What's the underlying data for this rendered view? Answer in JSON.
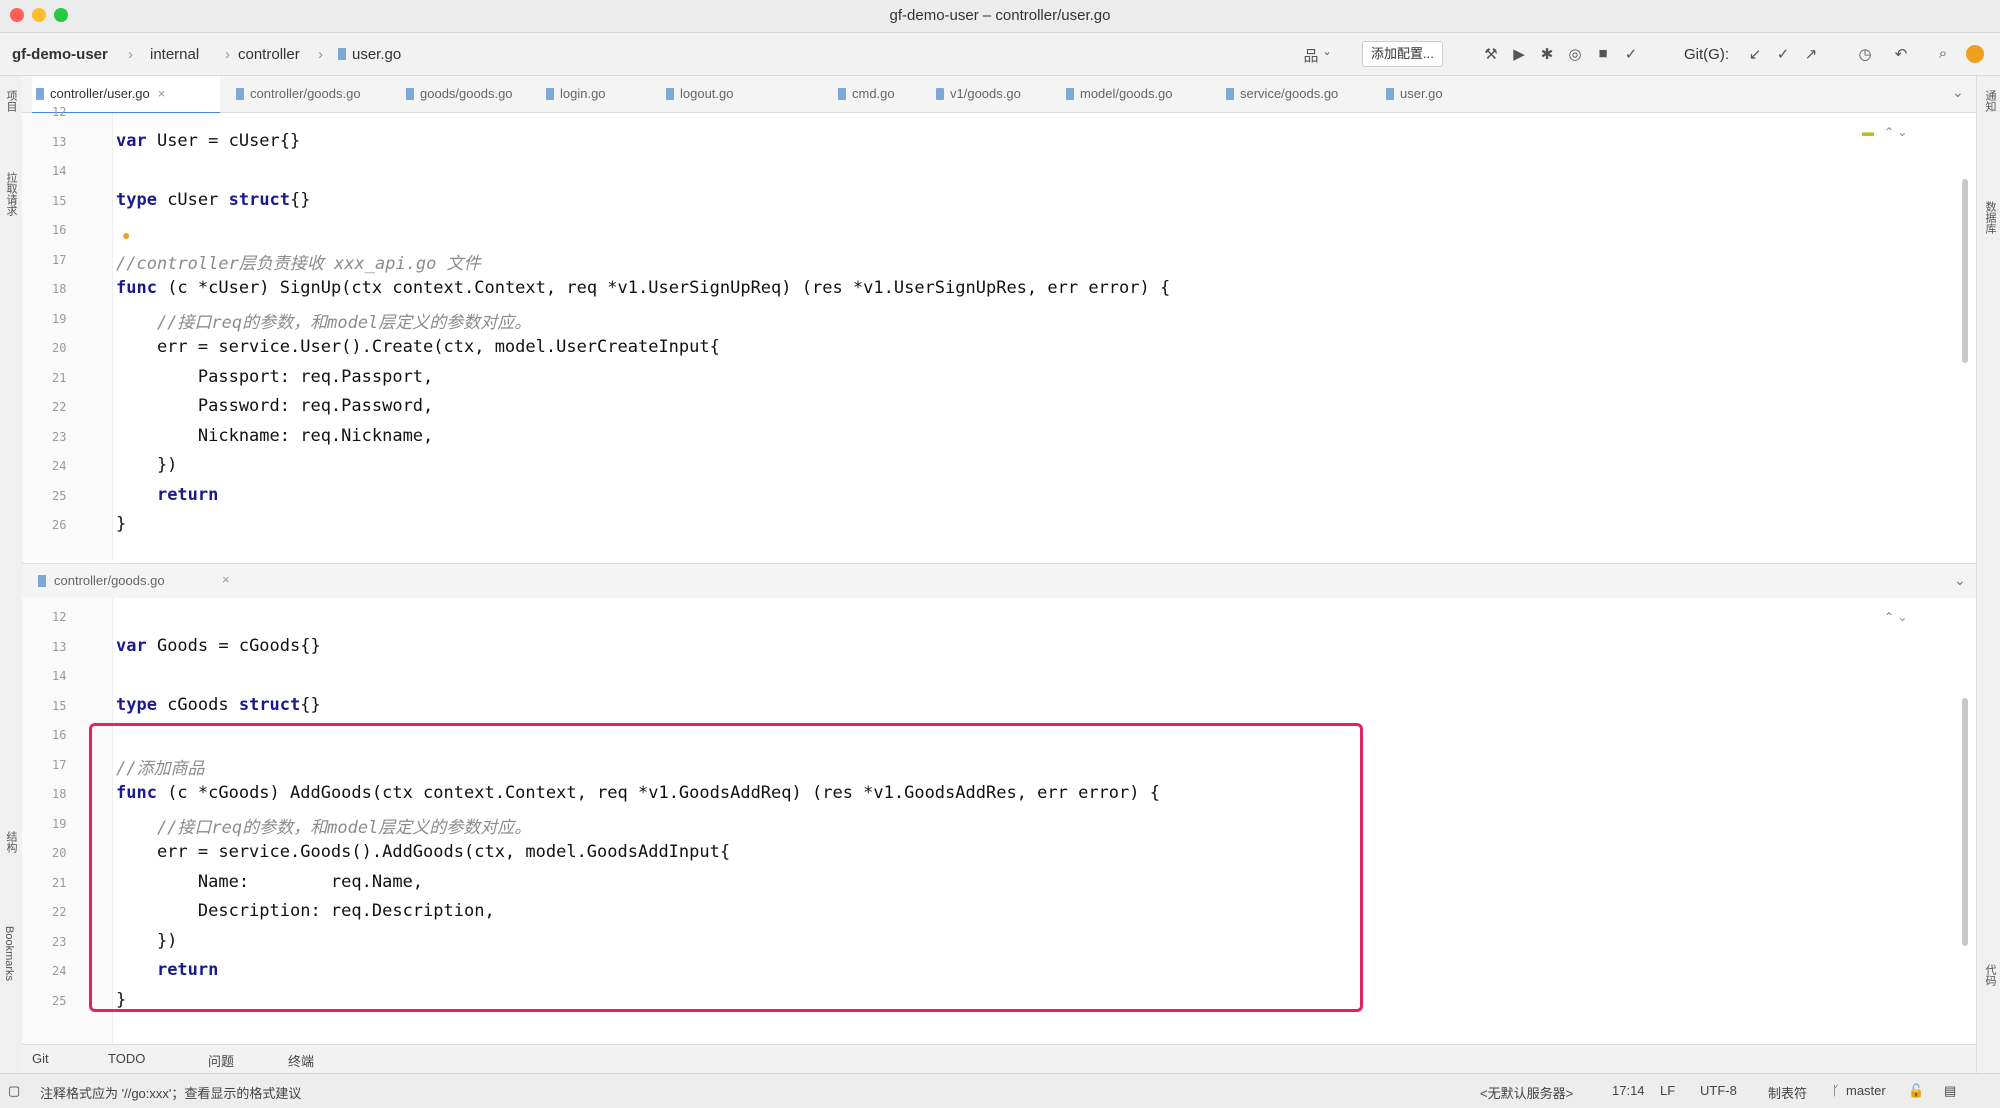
{
  "window": {
    "title": "gf-demo-user – controller/user.go"
  },
  "breadcrumb": [
    "gf-demo-user",
    "internal",
    "controller",
    "user.go"
  ],
  "toolbar": {
    "user_label": "品",
    "config_select": "添加配置...",
    "git_label": "Git(G):"
  },
  "left_strip": [
    "项目",
    "拉取请求",
    "结构",
    "Bookmarks"
  ],
  "right_strip": [
    "通知",
    "数据库",
    "代码"
  ],
  "tabs": [
    {
      "label": "controller/user.go",
      "active": true
    },
    {
      "label": "controller/goods.go"
    },
    {
      "label": "goods/goods.go"
    },
    {
      "label": "login.go"
    },
    {
      "label": "logout.go"
    },
    {
      "label": "cmd.go"
    },
    {
      "label": "v1/goods.go"
    },
    {
      "label": "model/goods.go"
    },
    {
      "label": "service/goods.go"
    },
    {
      "label": "user.go"
    }
  ],
  "editor_top": {
    "lines": [
      {
        "n": "12",
        "text": ""
      },
      {
        "n": "13",
        "text": "var User = cUser{}"
      },
      {
        "n": "14",
        "text": ""
      },
      {
        "n": "15",
        "text": "type cUser struct{}"
      },
      {
        "n": "16",
        "text": ""
      },
      {
        "n": "17",
        "text": "//controller层负责接收 xxx_api.go 文件"
      },
      {
        "n": "18",
        "text": "func (c *cUser) SignUp(ctx context.Context, req *v1.UserSignUpReq) (res *v1.UserSignUpRes, err error) {"
      },
      {
        "n": "19",
        "text": "    //接口req的参数，和model层定义的参数对应。"
      },
      {
        "n": "20",
        "text": "    err = service.User().Create(ctx, model.UserCreateInput{"
      },
      {
        "n": "21",
        "text": "        Passport: req.Passport,"
      },
      {
        "n": "22",
        "text": "        Password: req.Password,"
      },
      {
        "n": "23",
        "text": "        Nickname: req.Nickname,"
      },
      {
        "n": "24",
        "text": "    })"
      },
      {
        "n": "25",
        "text": "    return"
      },
      {
        "n": "26",
        "text": "}"
      }
    ]
  },
  "split_header": {
    "file": "controller/goods.go"
  },
  "editor_bottom": {
    "lines": [
      {
        "n": "12",
        "text": ""
      },
      {
        "n": "13",
        "text": "var Goods = cGoods{}"
      },
      {
        "n": "14",
        "text": ""
      },
      {
        "n": "15",
        "text": "type cGoods struct{}"
      },
      {
        "n": "16",
        "text": ""
      },
      {
        "n": "17",
        "text": "//添加商品"
      },
      {
        "n": "18",
        "text": "func (c *cGoods) AddGoods(ctx context.Context, req *v1.GoodsAddReq) (res *v1.GoodsAddRes, err error) {"
      },
      {
        "n": "19",
        "text": "    //接口req的参数，和model层定义的参数对应。"
      },
      {
        "n": "20",
        "text": "    err = service.Goods().AddGoods(ctx, model.GoodsAddInput{"
      },
      {
        "n": "21",
        "text": "        Name:        req.Name,"
      },
      {
        "n": "22",
        "text": "        Description: req.Description,"
      },
      {
        "n": "23",
        "text": "    })"
      },
      {
        "n": "24",
        "text": "    return"
      },
      {
        "n": "25",
        "text": "}"
      }
    ]
  },
  "bottom_tabs": [
    "Git",
    "TODO",
    "问题",
    "终端"
  ],
  "status": {
    "left": "注释格式应为 '//go:xxx'；查看显示的格式建议",
    "right": [
      "<无默认服务器>",
      "17:14",
      "LF",
      "UTF-8",
      "制表符",
      "master"
    ]
  },
  "colors": {
    "highlight_border": "#e0245e",
    "active_tab_underline": "#4a86e8"
  }
}
